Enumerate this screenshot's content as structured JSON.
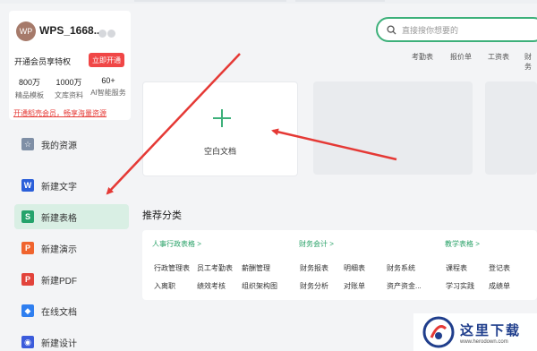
{
  "user": {
    "avatar_text": "WP",
    "name": "WPS_1668...",
    "vip_text": "开通会员享特权",
    "vip_button": "立即开通",
    "stats": [
      {
        "num": "800万",
        "label": "精品模板"
      },
      {
        "num": "1000万",
        "label": "文库资料"
      },
      {
        "num": "60+",
        "label": "AI智能服务"
      }
    ],
    "promo_link": "开通稻壳会员，畅享海量资源"
  },
  "nav": [
    {
      "label": "我的资源",
      "icon": "star-icon",
      "color": "#7f8fa6",
      "glyph": "☆"
    },
    {
      "label": "新建文字",
      "icon": "writer-icon",
      "color": "#2b5fd9",
      "glyph": "W"
    },
    {
      "label": "新建表格",
      "icon": "spreadsheet-icon",
      "color": "#24a36b",
      "glyph": "S"
    },
    {
      "label": "新建演示",
      "icon": "presentation-icon",
      "color": "#f0642e",
      "glyph": "P"
    },
    {
      "label": "新建PDF",
      "icon": "pdf-icon",
      "color": "#e2433b",
      "glyph": "P"
    },
    {
      "label": "在线文档",
      "icon": "online-doc-icon",
      "color": "#2f7ff0",
      "glyph": "◆"
    },
    {
      "label": "新建设计",
      "icon": "design-icon",
      "color": "#3b5bdb",
      "glyph": "◉"
    }
  ],
  "search": {
    "placeholder": "直接搜你想要的"
  },
  "quick_links": [
    "考勤表",
    "报价单",
    "工资表",
    "财务"
  ],
  "blank_doc_label": "空白文档",
  "section_title": "推荐分类",
  "categories": [
    {
      "title": "人事行政表格 >",
      "items": [
        "行政管理表",
        "员工考勤表",
        "薪酬管理",
        "入离职",
        "绩效考核",
        "组织架构图"
      ]
    },
    {
      "title": "财务会计 >",
      "items": [
        "财务报表",
        "明细表",
        "财务系统",
        "财务分析",
        "对账单",
        "资产资金..."
      ]
    },
    {
      "title": "教学表格 >",
      "items": [
        "课程表",
        "登记表",
        "学习实践",
        "成绩单"
      ]
    }
  ],
  "watermark": {
    "main": "这里下载",
    "url": "www.herodown.com"
  },
  "colors": {
    "accent": "#3db07a",
    "arrow": "#e53935",
    "vip": "#f04646"
  }
}
